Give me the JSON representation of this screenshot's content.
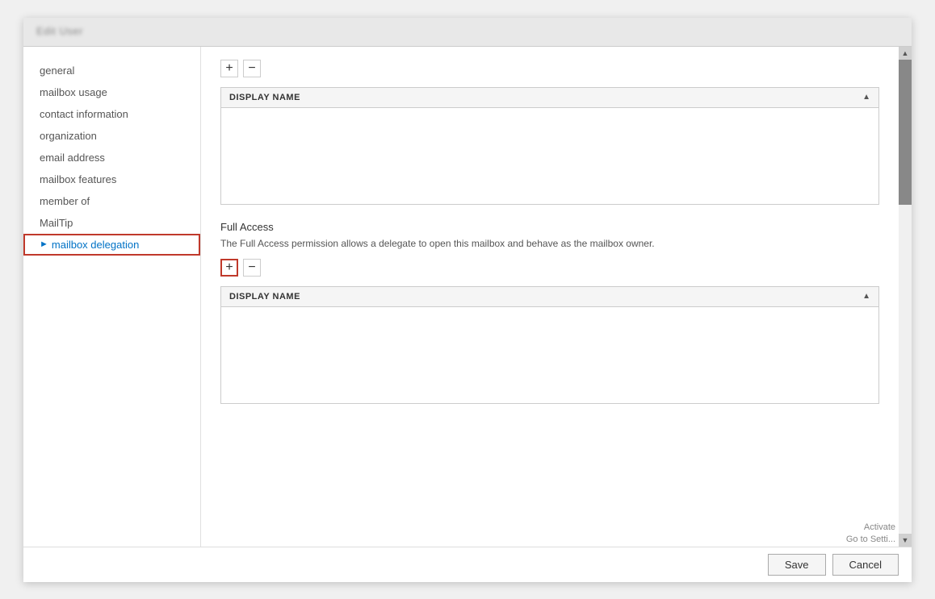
{
  "dialog": {
    "title": "Edit User",
    "header_blurred": true
  },
  "sidebar": {
    "items": [
      {
        "id": "general",
        "label": "general",
        "active": false,
        "arrow": false
      },
      {
        "id": "mailbox-usage",
        "label": "mailbox usage",
        "active": false,
        "arrow": false
      },
      {
        "id": "contact-information",
        "label": "contact information",
        "active": false,
        "arrow": false
      },
      {
        "id": "organization",
        "label": "organization",
        "active": false,
        "arrow": false
      },
      {
        "id": "email-address",
        "label": "email address",
        "active": false,
        "arrow": false
      },
      {
        "id": "mailbox-features",
        "label": "mailbox features",
        "active": false,
        "arrow": false
      },
      {
        "id": "member-of",
        "label": "member of",
        "active": false,
        "arrow": false
      },
      {
        "id": "mailtip",
        "label": "MailTip",
        "active": false,
        "arrow": false
      },
      {
        "id": "mailbox-delegation",
        "label": "mailbox delegation",
        "active": true,
        "arrow": true
      }
    ]
  },
  "send-as": {
    "section_toolbar": {
      "add_label": "+",
      "remove_label": "−"
    },
    "table": {
      "column_header": "DISPLAY NAME",
      "sort_icon": "▲",
      "rows": []
    }
  },
  "full-access": {
    "title": "Full Access",
    "description": "The Full Access permission allows a delegate to open this mailbox and behave as the mailbox owner.",
    "toolbar": {
      "add_label": "+",
      "remove_label": "−"
    },
    "table": {
      "column_header": "DISPLAY NAME",
      "sort_icon": "▲",
      "rows": []
    }
  },
  "footer": {
    "save_label": "Save",
    "cancel_label": "Cancel"
  },
  "activate": {
    "line1": "Activate",
    "line2": "Go to Setti..."
  }
}
